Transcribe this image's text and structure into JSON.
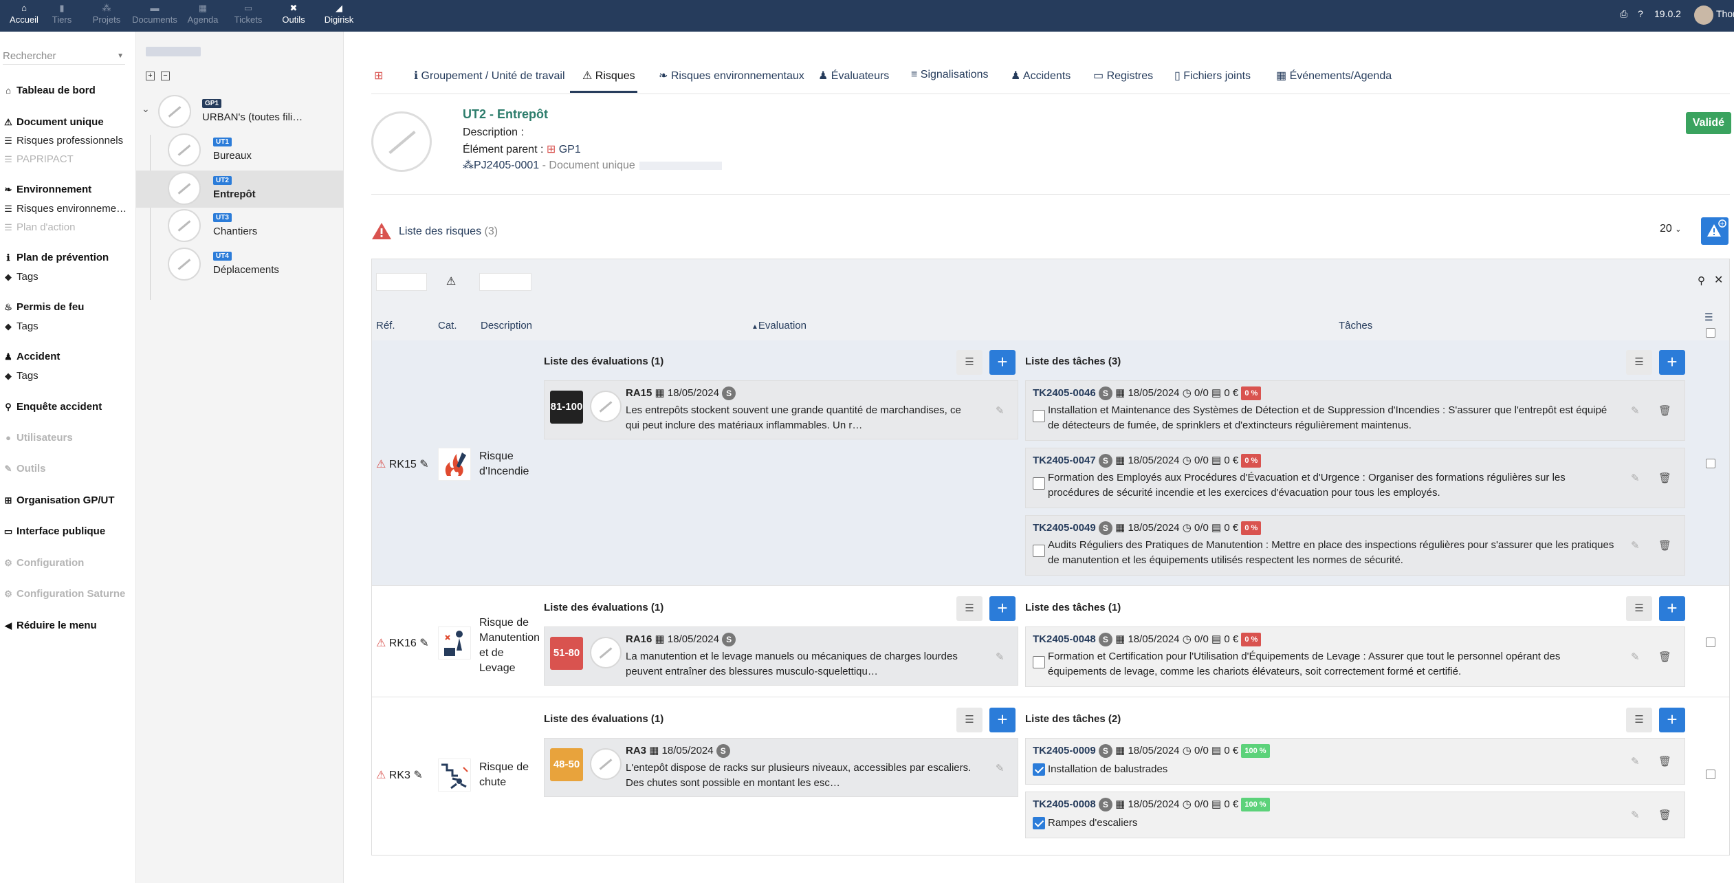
{
  "topbar": {
    "menus": [
      {
        "label": "Accueil",
        "icon": "home-icon",
        "active": true
      },
      {
        "label": "Tiers",
        "icon": "building-icon",
        "active": false
      },
      {
        "label": "Projets",
        "icon": "project-icon",
        "active": false
      },
      {
        "label": "Documents",
        "icon": "folder-icon",
        "active": false
      },
      {
        "label": "Agenda",
        "icon": "calendar-icon",
        "active": false
      },
      {
        "label": "Tickets",
        "icon": "ticket-icon",
        "active": false
      },
      {
        "label": "Outils",
        "icon": "tools-icon",
        "active": true
      },
      {
        "label": "Digirisk",
        "icon": "digirisk-icon",
        "active": true
      }
    ],
    "version": "19.0.2",
    "user": "Thor"
  },
  "sidebar": {
    "search_placeholder": "Rechercher",
    "items": [
      {
        "label": "Tableau de bord",
        "icon": "home-icon",
        "style": "b"
      },
      {
        "label": "Document unique",
        "icon": "warning-icon",
        "style": "b"
      },
      {
        "label": "Risques professionnels",
        "icon": "list-icon",
        "style": "sub"
      },
      {
        "label": "PAPRIPACT",
        "icon": "list-icon",
        "style": "dis"
      },
      {
        "label": "Environnement",
        "icon": "leaf-icon",
        "style": "b"
      },
      {
        "label": "Risques environneme…",
        "icon": "list-icon",
        "style": "sub"
      },
      {
        "label": "Plan d'action",
        "icon": "list-icon",
        "style": "dis"
      },
      {
        "label": "Plan de prévention",
        "icon": "info-icon",
        "style": "b"
      },
      {
        "label": "Tags",
        "icon": "tag-icon",
        "style": "sub"
      },
      {
        "label": "Permis de feu",
        "icon": "fire-icon",
        "style": "b"
      },
      {
        "label": "Tags",
        "icon": "tag-icon",
        "style": "sub"
      },
      {
        "label": "Accident",
        "icon": "user-injured-icon",
        "style": "b"
      },
      {
        "label": "Tags",
        "icon": "tag-icon",
        "style": "sub"
      },
      {
        "label": "Enquête accident",
        "icon": "search-icon",
        "style": "b"
      },
      {
        "label": "Utilisateurs",
        "icon": "user-icon",
        "style": "dis b"
      },
      {
        "label": "Outils",
        "icon": "wrench-icon",
        "style": "dis b"
      },
      {
        "label": "Organisation GP/UT",
        "icon": "sitemap-icon",
        "style": "b"
      },
      {
        "label": "Interface publique",
        "icon": "screen-icon",
        "style": "b"
      },
      {
        "label": "Configuration",
        "icon": "gear-icon",
        "style": "dis b"
      },
      {
        "label": "Configuration Saturne",
        "icon": "gear-icon",
        "style": "dis b"
      },
      {
        "label": "Réduire le menu",
        "icon": "chevron-left-icon",
        "style": "b"
      }
    ]
  },
  "tree": {
    "root": {
      "badge": "GP1",
      "label": "URBAN's (toutes fili…"
    },
    "children": [
      {
        "badge": "UT1",
        "label": "Bureaux",
        "selected": false
      },
      {
        "badge": "UT2",
        "label": "Entrepôt",
        "selected": true
      },
      {
        "badge": "UT3",
        "label": "Chantiers",
        "selected": false
      },
      {
        "badge": "UT4",
        "label": "Déplacements",
        "selected": false
      }
    ]
  },
  "tabs": [
    {
      "label": "Groupement / Unité de travail",
      "icon": "info-icon"
    },
    {
      "label": "Risques",
      "icon": "warning-icon",
      "active": true
    },
    {
      "label": "Risques environnementaux",
      "icon": "leaf-icon"
    },
    {
      "label": "Évaluateurs",
      "icon": "user-check-icon"
    },
    {
      "label": "Signalisations",
      "icon": "signs-icon"
    },
    {
      "label": "Accidents",
      "icon": "user-injured-icon"
    },
    {
      "label": "Registres",
      "icon": "register-icon"
    },
    {
      "label": "Fichiers joints",
      "icon": "file-icon"
    },
    {
      "label": "Événements/Agenda",
      "icon": "calendar-icon"
    }
  ],
  "header": {
    "title": "UT2 - Entrepôt",
    "description_label": "Description :",
    "parent_label": "Élément parent :",
    "parent_value": "GP1",
    "project_ref": "PJ2405-0001",
    "project_label": " - Document unique",
    "status": "Validé"
  },
  "risk_list": {
    "title": "Liste des risques",
    "count": "(3)",
    "per_page": "20",
    "columns": {
      "ref": "Réf.",
      "cat": "Cat.",
      "description": "Description",
      "evaluation": "Evaluation",
      "tasks": "Tâches"
    },
    "eval_header": "Liste des évaluations (1)",
    "rows": [
      {
        "ref": "RK15",
        "description": "Risque d'Incendie",
        "evaluation": {
          "score": "81-100",
          "color": "#222222",
          "ref": "RA15",
          "date": "18/05/2024",
          "tag": "S",
          "text": "Les entrepôts stockent souvent une grande quantité de marchandises, ce qui peut inclure des matériaux inflammables. Un r…"
        },
        "tasks_header": "Liste des tâches (3)",
        "tasks": [
          {
            "ref": "TK2405-0046",
            "date": "18/05/2024",
            "time": "0/0",
            "cost": "0 €",
            "pct": "0 %",
            "done": false,
            "text": "Installation et Maintenance des Systèmes de Détection et de Suppression d'Incendies : S'assurer que l'entrepôt est équipé de détecteurs de fumée, de sprinklers et d'extincteurs régulièrement maintenus."
          },
          {
            "ref": "TK2405-0047",
            "date": "18/05/2024",
            "time": "0/0",
            "cost": "0 €",
            "pct": "0 %",
            "done": false,
            "text": "Formation des Employés aux Procédures d'Évacuation et d'Urgence : Organiser des formations régulières sur les procédures de sécurité incendie et les exercices d'évacuation pour tous les employés."
          },
          {
            "ref": "TK2405-0049",
            "date": "18/05/2024",
            "time": "0/0",
            "cost": "0 €",
            "pct": "0 %",
            "done": false,
            "text": "Audits Réguliers des Pratiques de Manutention : Mettre en place des inspections régulières pour s'assurer que les pratiques de manutention et les équipements utilisés respectent les normes de sécurité."
          }
        ]
      },
      {
        "ref": "RK16",
        "description": "Risque de Manutention et de Levage",
        "evaluation": {
          "score": "51-80",
          "color": "#d9534f",
          "ref": "RA16",
          "date": "18/05/2024",
          "tag": "S",
          "text": "La manutention et le levage manuels ou mécaniques de charges lourdes peuvent entraîner des blessures musculo-squelettiqu…"
        },
        "tasks_header": "Liste des tâches (1)",
        "tasks": [
          {
            "ref": "TK2405-0048",
            "date": "18/05/2024",
            "time": "0/0",
            "cost": "0 €",
            "pct": "0 %",
            "done": false,
            "text": "Formation et Certification pour l'Utilisation d'Équipements de Levage : Assurer que tout le personnel opérant des équipements de levage, comme les chariots élévateurs, soit correctement formé et certifié."
          }
        ]
      },
      {
        "ref": "RK3",
        "description": "Risque de chute",
        "evaluation": {
          "score": "48-50",
          "color": "#e8a33c",
          "ref": "RA3",
          "date": "18/05/2024",
          "tag": "S",
          "text": "L'entepôt dispose de racks sur plusieurs niveaux, accessibles par escaliers. Des chutes sont possible en montant les esc…"
        },
        "tasks_header": "Liste des tâches (2)",
        "tasks": [
          {
            "ref": "TK2405-0009",
            "date": "18/05/2024",
            "time": "0/0",
            "cost": "0 €",
            "pct": "100 %",
            "done": true,
            "text": "Installation de balustrades"
          },
          {
            "ref": "TK2405-0008",
            "date": "18/05/2024",
            "time": "0/0",
            "cost": "0 €",
            "pct": "100 %",
            "done": true,
            "text": "Rampes d'escaliers"
          }
        ]
      }
    ]
  }
}
